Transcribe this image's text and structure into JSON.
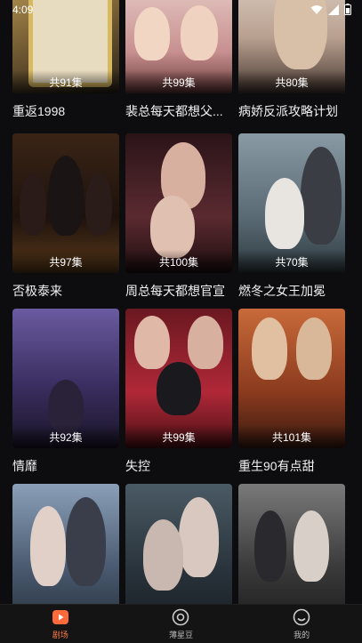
{
  "status_bar": {
    "time": "4:09"
  },
  "dramas": [
    {
      "title": "重返1998",
      "episodes": "共91集",
      "colors": [
        "#5a4a30",
        "#c8b27a"
      ]
    },
    {
      "title": "裴总每天都想父...",
      "episodes": "共99集",
      "colors": [
        "#6a3a3a",
        "#e6c9b8"
      ]
    },
    {
      "title": "病娇反派攻略计划",
      "episodes": "共80集",
      "colors": [
        "#4a3a32",
        "#d8c0a8"
      ]
    },
    {
      "title": "否极泰来",
      "episodes": "共97集",
      "colors": [
        "#2a1a12",
        "#b88a4a"
      ]
    },
    {
      "title": "周总每天都想官宣",
      "episodes": "共100集",
      "colors": [
        "#3a1a1e",
        "#c89a9a"
      ]
    },
    {
      "title": "燃冬之女王加冕",
      "episodes": "共70集",
      "colors": [
        "#3e4a52",
        "#d8d8d8"
      ]
    },
    {
      "title": "情靡",
      "episodes": "共92集",
      "colors": [
        "#2a2440",
        "#8a7ab0"
      ]
    },
    {
      "title": "失控",
      "episodes": "共99集",
      "colors": [
        "#4a1218",
        "#c83040"
      ]
    },
    {
      "title": "重生90有点甜",
      "episodes": "共101集",
      "colors": [
        "#5a2a1a",
        "#d8a070"
      ]
    },
    {
      "title": "",
      "episodes": "",
      "colors": [
        "#3a4a5a",
        "#b0c0d0"
      ]
    },
    {
      "title": "",
      "episodes": "",
      "colors": [
        "#2e3a44",
        "#a8b8c0"
      ]
    },
    {
      "title": "",
      "episodes": "",
      "colors": [
        "#3a3a3a",
        "#c8c8c8"
      ]
    }
  ],
  "tabs": [
    {
      "label": "剧场",
      "icon": "theater-icon",
      "active": true
    },
    {
      "label": "薄星豆",
      "icon": "coin-icon",
      "active": false
    },
    {
      "label": "我的",
      "icon": "profile-icon",
      "active": false
    }
  ],
  "accent_color": "#ff6a3d"
}
